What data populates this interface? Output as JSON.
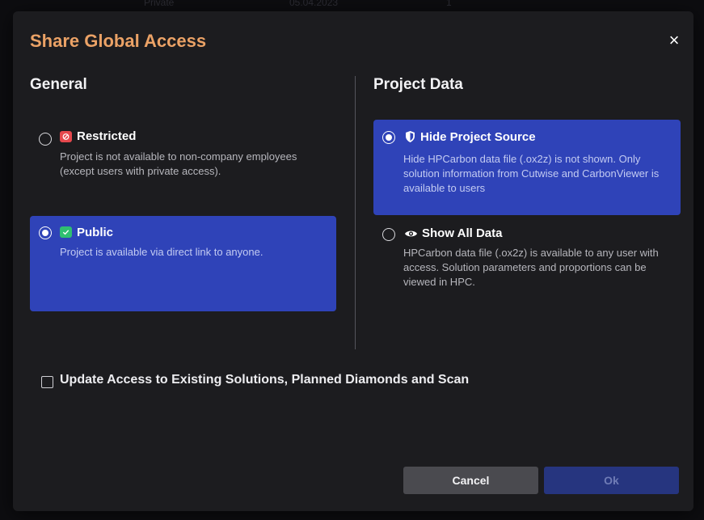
{
  "background": {
    "row_text_1": "Private",
    "row_text_2": "05.04.2023",
    "row_text_3": "1"
  },
  "modal": {
    "title": "Share Global Access",
    "close_label": "×"
  },
  "general": {
    "heading": "General",
    "options": [
      {
        "label": "Restricted",
        "description": "Project is not available to non-company employees (except users with private access).",
        "selected": false,
        "icon": "restricted-icon",
        "icon_color": "#e5484d"
      },
      {
        "label": "Public",
        "description": "Project is available via direct link to anyone.",
        "selected": true,
        "icon": "check-icon",
        "icon_color": "#2fbf71"
      }
    ]
  },
  "project_data": {
    "heading": "Project Data",
    "options": [
      {
        "label": "Hide Project Source",
        "description": "Hide HPCarbon data file (.ox2z) is not shown. Only solution information from Cutwise and CarbonViewer is available to users",
        "selected": true,
        "icon": "shield-icon"
      },
      {
        "label": "Show All Data",
        "description": "HPCarbon data file (.ox2z) is available to any user with access. Solution parameters and proportions can be viewed in HPC.",
        "selected": false,
        "icon": "eye-icon"
      }
    ]
  },
  "update_access": {
    "label": "Update Access to Existing Solutions, Planned Diamonds and Scan",
    "checked": false
  },
  "buttons": {
    "cancel": "Cancel",
    "ok": "Ok"
  },
  "colors": {
    "accent_title": "#eba266",
    "selected_bg": "#2f43b8",
    "modal_bg": "#1c1c1f"
  }
}
